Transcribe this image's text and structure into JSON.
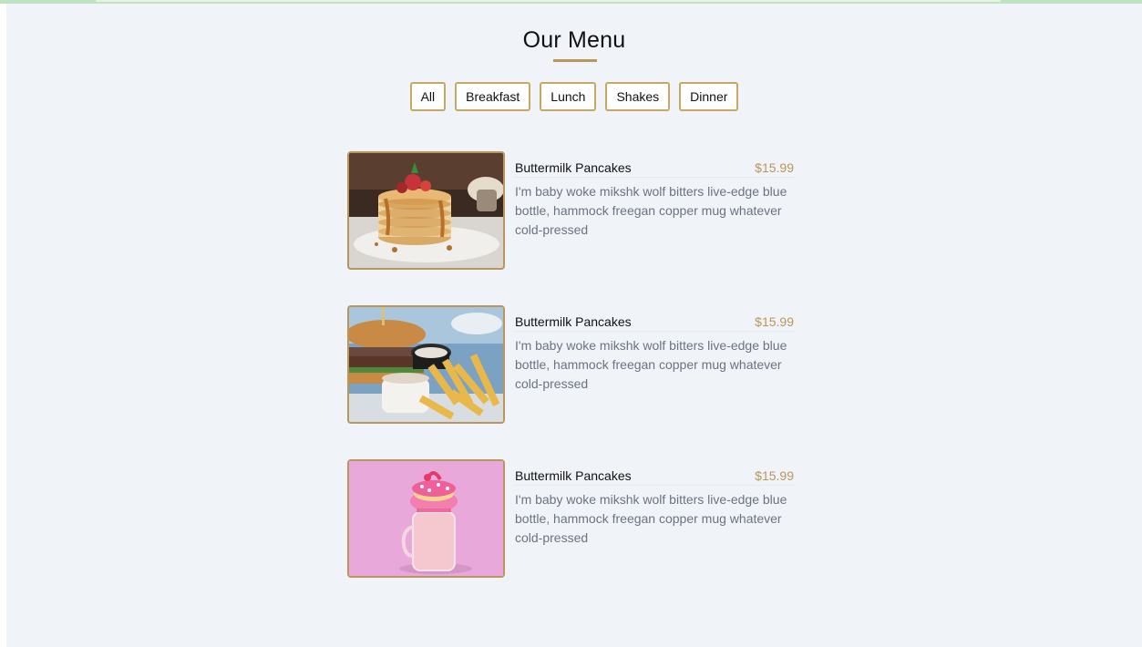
{
  "header": {
    "title": "Our Menu"
  },
  "filters": [
    {
      "label": "All"
    },
    {
      "label": "Breakfast"
    },
    {
      "label": "Lunch"
    },
    {
      "label": "Shakes"
    },
    {
      "label": "Dinner"
    }
  ],
  "items": [
    {
      "name": "Buttermilk Pancakes",
      "price": "$15.99",
      "desc": "I'm baby woke mikshk wolf bitters live-edge blue bottle, hammock freegan copper mug whatever cold-pressed",
      "image": "pancakes-photo"
    },
    {
      "name": "Buttermilk Pancakes",
      "price": "$15.99",
      "desc": "I'm baby woke mikshk wolf bitters live-edge blue bottle, hammock freegan copper mug whatever cold-pressed",
      "image": "burger-fries-photo"
    },
    {
      "name": "Buttermilk Pancakes",
      "price": "$15.99",
      "desc": "I'm baby woke mikshk wolf bitters live-edge blue bottle, hammock freegan copper mug whatever cold-pressed",
      "image": "pink-shake-photo"
    }
  ],
  "colors": {
    "accent": "#b9975b",
    "background": "#f0f3f8",
    "text": "#111111",
    "muted": "#6b7380"
  }
}
